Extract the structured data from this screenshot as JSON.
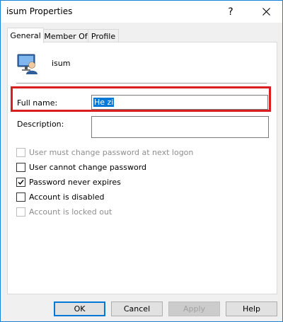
{
  "window": {
    "title": "isum Properties",
    "help_glyph": "?",
    "close_glyph": "✕"
  },
  "tabs": [
    {
      "label": "General",
      "active": true
    },
    {
      "label": "Member Of",
      "active": false
    },
    {
      "label": "Profile",
      "active": false
    }
  ],
  "user": {
    "name": "isum",
    "icon": "user-computer-icon"
  },
  "fields": {
    "full_name_label": "Full name:",
    "full_name_value": "He zi",
    "description_label": "Description:",
    "description_value": ""
  },
  "checkboxes": [
    {
      "label": "User must change password at next logon",
      "checked": false,
      "enabled": false
    },
    {
      "label": "User cannot change password",
      "checked": false,
      "enabled": true
    },
    {
      "label": "Password never expires",
      "checked": true,
      "enabled": true
    },
    {
      "label": "Account is disabled",
      "checked": false,
      "enabled": true
    },
    {
      "label": "Account is locked out",
      "checked": false,
      "enabled": false
    }
  ],
  "buttons": {
    "ok": "OK",
    "cancel": "Cancel",
    "apply": "Apply",
    "help": "Help"
  },
  "highlight_color": "#d81e1e",
  "accent_color": "#0078d7"
}
